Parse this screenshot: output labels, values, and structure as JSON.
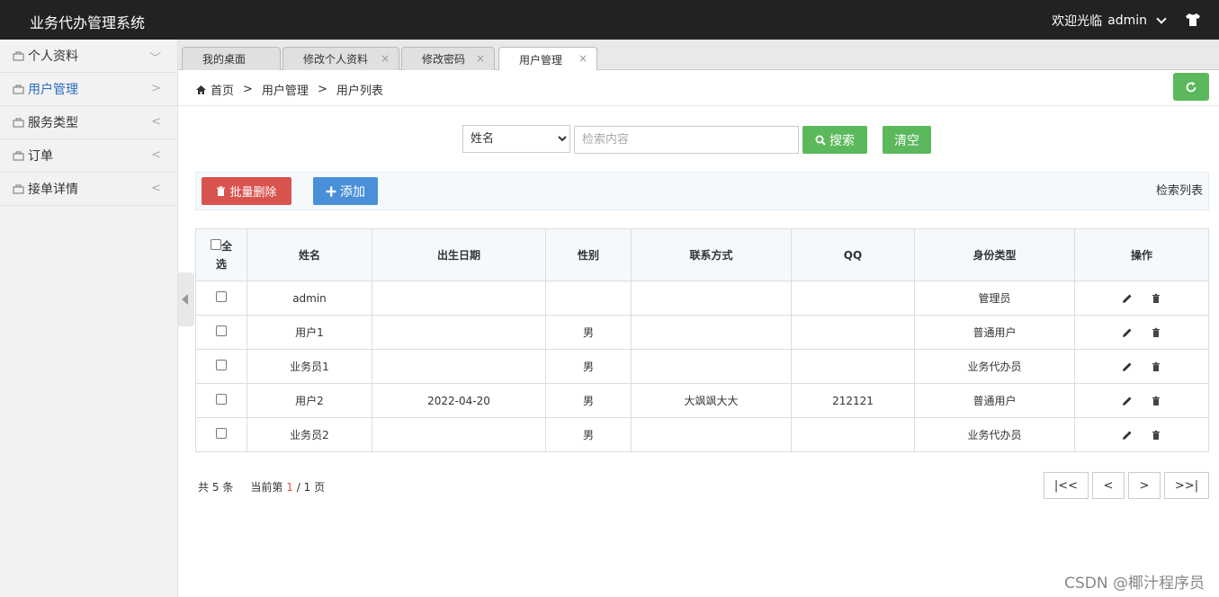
{
  "header": {
    "app_title": "业务代办管理系统",
    "welcome": "欢迎光临",
    "username": "admin"
  },
  "sidebar": {
    "items": [
      {
        "label": "个人资料",
        "arrow": "﹀",
        "active": false
      },
      {
        "label": "用户管理",
        "arrow": ">",
        "active": true
      },
      {
        "label": "服务类型",
        "arrow": "<",
        "active": false
      },
      {
        "label": "订单",
        "arrow": "<",
        "active": false
      },
      {
        "label": "接单详情",
        "arrow": "<",
        "active": false
      }
    ]
  },
  "tabs": [
    {
      "label": "我的桌面",
      "closable": false
    },
    {
      "label": "修改个人资料",
      "closable": true
    },
    {
      "label": "修改密码",
      "closable": true
    },
    {
      "label": "用户管理",
      "closable": true,
      "active": true
    }
  ],
  "tab_close": "×",
  "breadcrumb": {
    "home": "首页",
    "sep": ">",
    "section": "用户管理",
    "page": "用户列表"
  },
  "search": {
    "field": "姓名",
    "placeholder": "检索内容",
    "search_label": "搜索",
    "clear_label": "清空"
  },
  "toolbar": {
    "delete_label": "批量删除",
    "add_label": "添加",
    "list_label": "检索列表"
  },
  "table": {
    "select_all_1": "全",
    "select_all_2": "选",
    "columns": [
      "姓名",
      "出生日期",
      "性别",
      "联系方式",
      "QQ",
      "身份类型",
      "操作"
    ],
    "rows": [
      {
        "name": "admin",
        "birth": "",
        "gender": "",
        "contact": "",
        "qq": "",
        "type": "管理员"
      },
      {
        "name": "用户1",
        "birth": "",
        "gender": "男",
        "contact": "",
        "qq": "",
        "type": "普通用户"
      },
      {
        "name": "业务员1",
        "birth": "",
        "gender": "男",
        "contact": "",
        "qq": "",
        "type": "业务代办员"
      },
      {
        "name": "用户2",
        "birth": "2022-04-20",
        "gender": "男",
        "contact": "大飒飒大大",
        "qq": "212121",
        "type": "普通用户"
      },
      {
        "name": "业务员2",
        "birth": "",
        "gender": "男",
        "contact": "",
        "qq": "",
        "type": "业务代办员"
      }
    ]
  },
  "pagination": {
    "total_prefix": "共",
    "total": "5",
    "total_suffix": "条",
    "current_prefix": "当前第",
    "current": "1",
    "slash": "/",
    "pages": "1",
    "pages_suffix": "页",
    "first": "|<<",
    "prev": "<",
    "next": ">",
    "last": ">>|"
  },
  "watermark": "CSDN @椰汁程序员",
  "colors": {
    "topbar": "#222222",
    "success": "#5cb85c",
    "danger": "#d9534f",
    "primary": "#4a90d9",
    "active_link": "#2a6dbd"
  }
}
